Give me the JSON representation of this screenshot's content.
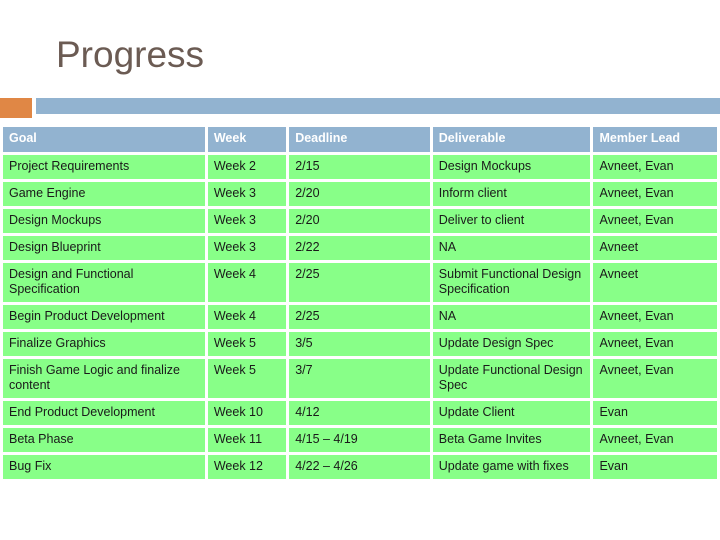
{
  "slide": {
    "title": "Progress",
    "accent_orange": "#E08745",
    "accent_blue": "#92B3D0",
    "cell_green": "#88FF88",
    "title_color": "#6B5B53"
  },
  "table": {
    "headers": [
      "Goal",
      "Week",
      "Deadline",
      "Deliverable",
      "Member Lead"
    ],
    "rows": [
      {
        "goal": "Project Requirements",
        "week": "Week 2",
        "deadline": "2/15",
        "deliverable": "Design Mockups",
        "member_lead": "Avneet, Evan"
      },
      {
        "goal": "Game Engine",
        "week": "Week 3",
        "deadline": "2/20",
        "deliverable": "Inform client",
        "member_lead": "Avneet, Evan"
      },
      {
        "goal": "Design Mockups",
        "week": "Week 3",
        "deadline": "2/20",
        "deliverable": "Deliver to client",
        "member_lead": "Avneet, Evan"
      },
      {
        "goal": "Design Blueprint",
        "week": "Week 3",
        "deadline": "2/22",
        "deliverable": "NA",
        "member_lead": "Avneet"
      },
      {
        "goal": "Design and Functional Specification",
        "week": "Week 4",
        "deadline": "2/25",
        "deliverable": "Submit Functional Design Specification",
        "member_lead": "Avneet"
      },
      {
        "goal": "Begin Product Development",
        "week": "Week 4",
        "deadline": "2/25",
        "deliverable": "NA",
        "member_lead": "Avneet, Evan"
      },
      {
        "goal": "Finalize Graphics",
        "week": "Week 5",
        "deadline": "3/5",
        "deliverable": "Update Design Spec",
        "member_lead": "Avneet, Evan"
      },
      {
        "goal": "Finish Game Logic and finalize content",
        "week": "Week 5",
        "deadline": "3/7",
        "deliverable": "Update Functional Design Spec",
        "member_lead": "Avneet, Evan"
      },
      {
        "goal": "End Product Development",
        "week": "Week 10",
        "deadline": "4/12",
        "deliverable": "Update Client",
        "member_lead": "Evan"
      },
      {
        "goal": "Beta Phase",
        "week": "Week 11",
        "deadline": "4/15 – 4/19",
        "deliverable": "Beta Game Invites",
        "member_lead": "Avneet, Evan"
      },
      {
        "goal": "Bug Fix",
        "week": "Week 12",
        "deadline": "4/22 – 4/26",
        "deliverable": "Update game with fixes",
        "member_lead": "Evan"
      }
    ]
  }
}
